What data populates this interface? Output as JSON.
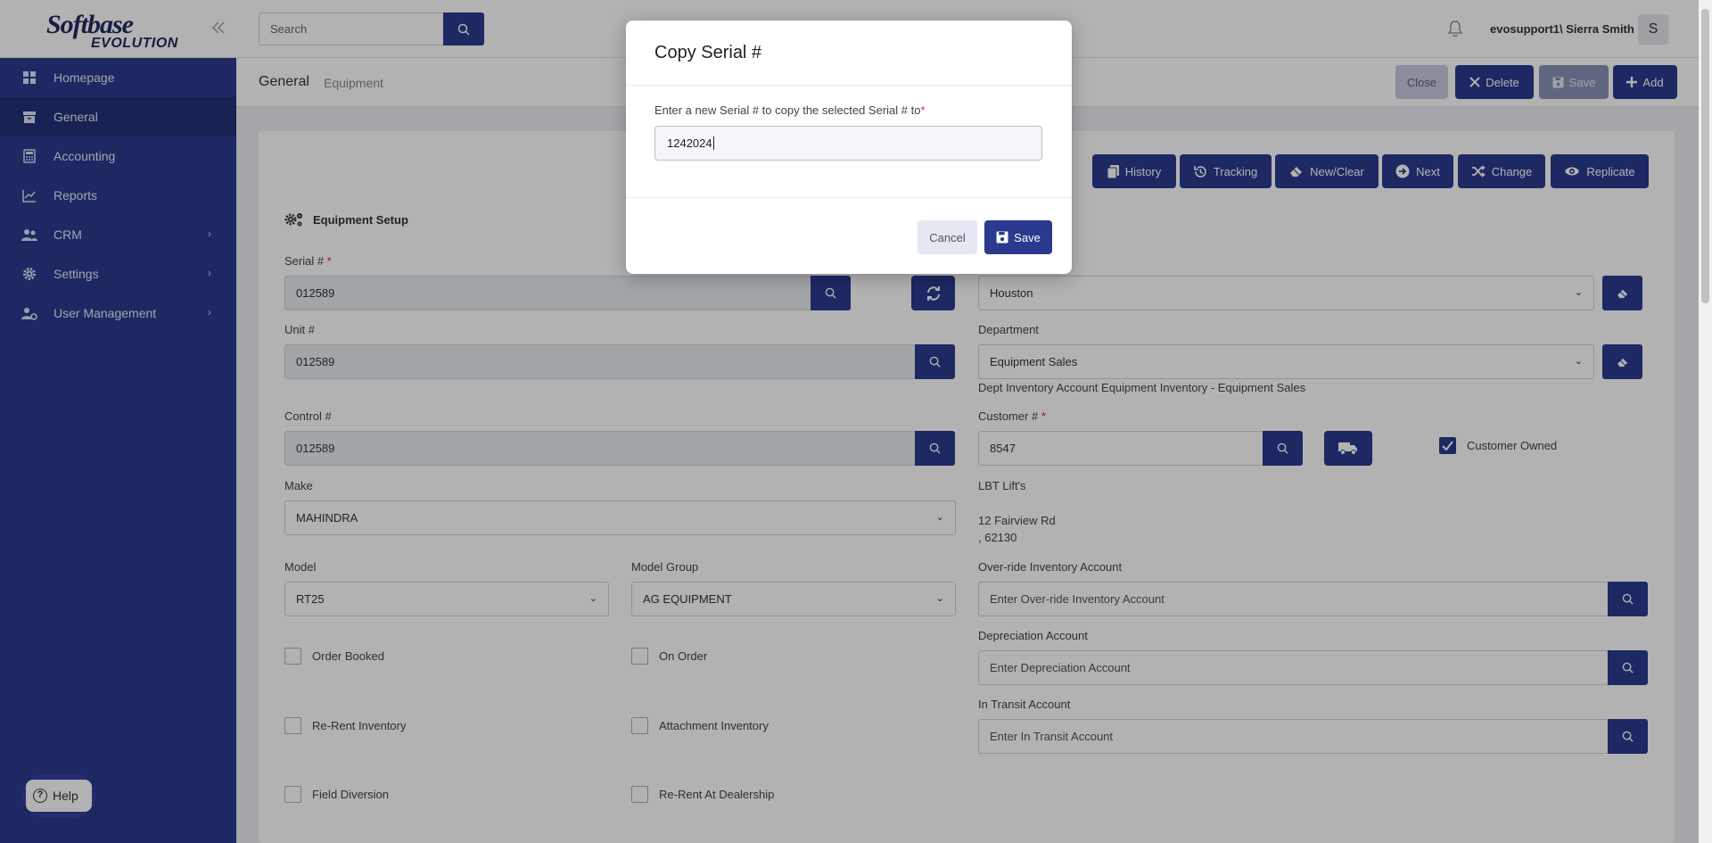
{
  "brand": {
    "line1": "Softbase",
    "line2": "EVOLUTION"
  },
  "sidebar": {
    "items": [
      {
        "label": "Homepage",
        "icon": "grid-icon"
      },
      {
        "label": "General",
        "icon": "archive-icon",
        "active": true
      },
      {
        "label": "Accounting",
        "icon": "calculator-icon"
      },
      {
        "label": "Reports",
        "icon": "chart-icon"
      },
      {
        "label": "CRM",
        "icon": "users-icon",
        "has_children": true
      },
      {
        "label": "Settings",
        "icon": "gear-icon",
        "has_children": true
      },
      {
        "label": "User Management",
        "icon": "user-gear-icon",
        "has_children": true
      }
    ]
  },
  "topbar": {
    "search_placeholder": "Search",
    "user": "evosupport1\\ Sierra Smith",
    "avatar_letter": "S"
  },
  "subheader": {
    "crumb_main": "General",
    "crumb_sub": "Equipment",
    "buttons": {
      "close": "Close",
      "delete": "Delete",
      "save": "Save",
      "add": "Add"
    }
  },
  "toolbar": {
    "history": "History",
    "tracking": "Tracking",
    "new_clear": "New/Clear",
    "next": "Next",
    "change": "Change",
    "replicate": "Replicate"
  },
  "form": {
    "section_title": "Equipment Setup",
    "serial_label": "Serial #",
    "serial_value": "012589",
    "unit_label": "Unit #",
    "unit_value": "012589",
    "control_label": "Control #",
    "control_value": "012589",
    "make_label": "Make",
    "make_value": "MAHINDRA",
    "model_label": "Model",
    "model_value": "RT25",
    "model_group_label": "Model Group",
    "model_group_value": "AG EQUIPMENT",
    "location_value": "Houston",
    "department_label": "Department",
    "department_value": "Equipment Sales",
    "dept_inventory_text": "Dept Inventory Account Equipment Inventory - Equipment Sales",
    "customer_label": "Customer #",
    "customer_value": "8547",
    "customer_owned_label": "Customer Owned",
    "customer_name": "LBT Lift's",
    "customer_address1": "12 Fairview Rd",
    "customer_address2": ", 62130",
    "override_label": "Over-ride Inventory Account",
    "override_placeholder": "Enter Over-ride Inventory Account",
    "depreciation_label": "Depreciation Account",
    "depreciation_placeholder": "Enter Depreciation Account",
    "transit_label": "In Transit Account",
    "transit_placeholder": "Enter In Transit Account",
    "checkboxes": {
      "order_booked": "Order Booked",
      "on_order": "On Order",
      "rerent_inventory": "Re-Rent Inventory",
      "attachment_inventory": "Attachment Inventory",
      "field_diversion": "Field Diversion",
      "rerent_dealership": "Re-Rent At Dealership"
    }
  },
  "modal": {
    "title": "Copy Serial #",
    "label": "Enter a new Serial # to copy the selected Serial # to",
    "required_mark": "*",
    "input_value": "1242024",
    "cancel": "Cancel",
    "save": "Save"
  },
  "help": {
    "label": "Help"
  },
  "colors": {
    "primary": "#2b3a8e",
    "sidebar": "#2b3a8e",
    "required": "#d32f2f"
  }
}
